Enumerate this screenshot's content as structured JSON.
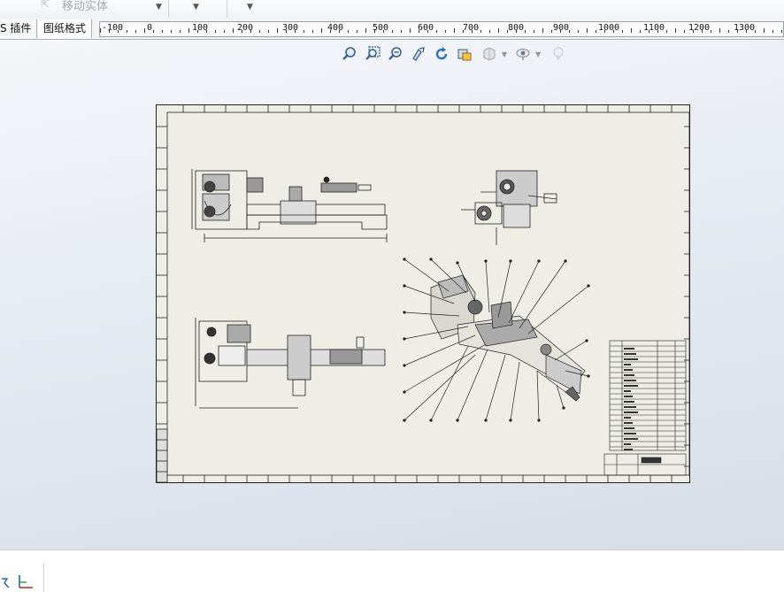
{
  "toolbar": {
    "ghost_command_label": "移动实体",
    "icons": [
      "move-entity-icon",
      "dropdown-caret-icon"
    ]
  },
  "tabs": [
    {
      "label": "S 插件",
      "active": false
    },
    {
      "label": "图纸格式",
      "active": true
    }
  ],
  "ruler": {
    "labels": [
      "-100",
      "0",
      "100",
      "200",
      "300",
      "400",
      "500",
      "600",
      "700",
      "800",
      "900",
      "1000",
      "1100",
      "1200",
      "1300"
    ]
  },
  "view_toolbar": {
    "icons": [
      "zoom-to-fit-icon",
      "zoom-to-area-icon",
      "zoom-in-out-icon",
      "pan-icon",
      "rotate-icon",
      "display-style-icon",
      "view-orientation-icon",
      "hide-show-items-icon",
      "lighting-icon"
    ]
  },
  "drawing": {
    "description_icons": [
      "drawing-sheet",
      "front-view",
      "side-view",
      "top-view",
      "isometric-view",
      "bill-of-materials",
      "title-block"
    ],
    "accent_line_color": "#222222",
    "sheet_color": "#eeeee6"
  },
  "statusbar": {
    "icons": [
      "sketch-relations-icon",
      "coordinate-axes-icon"
    ]
  }
}
